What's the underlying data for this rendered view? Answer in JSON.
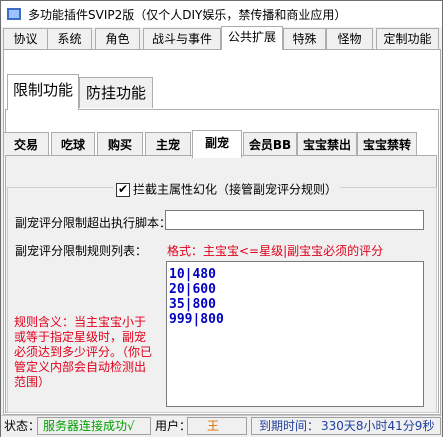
{
  "window": {
    "title": "多功能插件SVIP2版（仅个人DIY娱乐，禁传播和商业应用）"
  },
  "main_tabs": [
    {
      "label": "协议"
    },
    {
      "label": "系统"
    },
    {
      "label": "角色"
    },
    {
      "label": "战斗与事件"
    },
    {
      "label": "公共扩展",
      "selected": true
    },
    {
      "label": "特殊"
    },
    {
      "label": "怪物"
    },
    {
      "label": "定制功能"
    }
  ],
  "sub_tabs": [
    {
      "label": "限制功能",
      "selected": true
    },
    {
      "label": "防挂功能"
    }
  ],
  "inner_tabs": [
    {
      "label": "交易"
    },
    {
      "label": "吃球"
    },
    {
      "label": "购买"
    },
    {
      "label": "主宠"
    },
    {
      "label": "副宠",
      "selected": true
    },
    {
      "label": "会员BB"
    },
    {
      "label": "宝宝禁出"
    },
    {
      "label": "宝宝禁转"
    }
  ],
  "panel": {
    "checkbox_label": "拦截主属性幻化（接管副宠评分规则）",
    "checkbox_checked": true,
    "script_label": "副宠评分限制超出执行脚本：",
    "script_value": "",
    "rules_label": "副宠评分限制规则列表：",
    "format_hint": "格式：主宝宝<=星级|副宝宝必须的评分",
    "rules": [
      "10|480",
      "20|600",
      "35|800",
      "999|800"
    ],
    "note": "规则含义：当主宝宝小于或等于指定星级时，副宠必须达到多少评分。（你已管定义内部会自动检测出范围）"
  },
  "status": {
    "state_label": "状态：",
    "state_value": "服务器连接成功√",
    "user_label": "用户：",
    "user_value": "王",
    "expire_label": "到期时间：",
    "expire_value": "330天8小时41分9秒"
  },
  "colors": {
    "accent_red": "#e0001b",
    "list_blue": "#0000c0",
    "status_green": "#00a000",
    "user_orange": "#e07000",
    "expire_blue": "#1f3fa0"
  }
}
